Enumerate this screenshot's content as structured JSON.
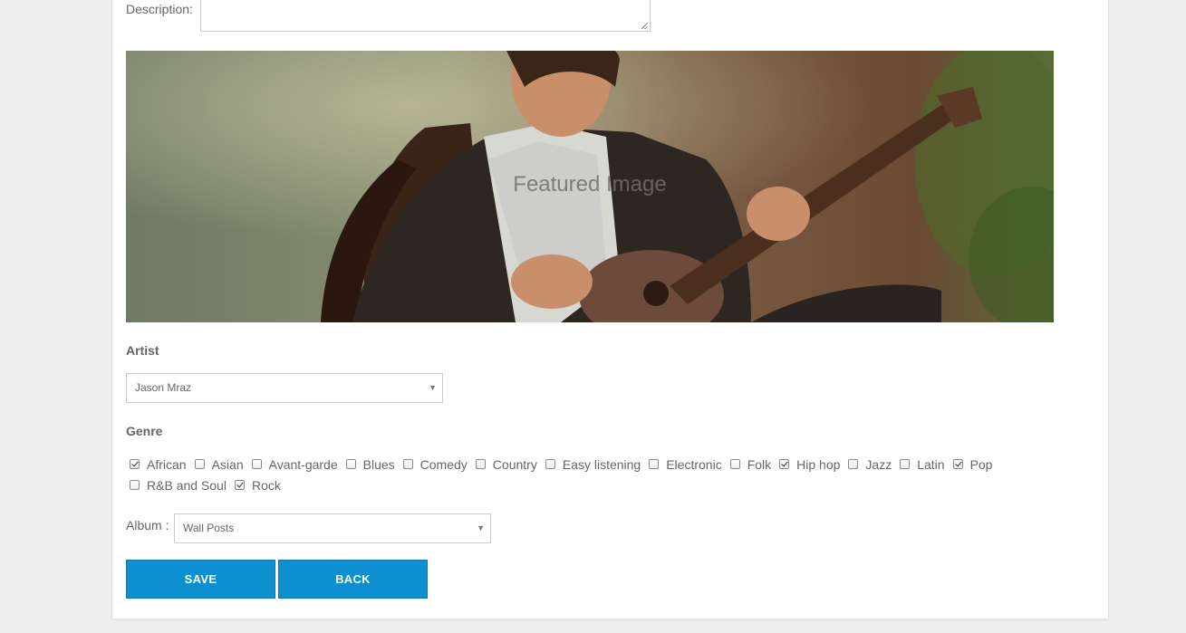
{
  "form": {
    "description_label": "Description:",
    "featured_image_caption": "Featured Image",
    "artist_label": "Artist",
    "artist_value": "Jason Mraz",
    "genre_label": "Genre",
    "genres_row1": [
      {
        "label": "African",
        "checked": true
      },
      {
        "label": "Asian",
        "checked": false
      },
      {
        "label": "Avant-garde",
        "checked": false
      },
      {
        "label": "Blues",
        "checked": false
      },
      {
        "label": "Comedy",
        "checked": false
      },
      {
        "label": "Country",
        "checked": false
      },
      {
        "label": "Easy listening",
        "checked": false
      },
      {
        "label": "Electronic",
        "checked": false
      },
      {
        "label": "Folk",
        "checked": false
      },
      {
        "label": "Hip hop",
        "checked": true
      },
      {
        "label": "Jazz",
        "checked": false
      },
      {
        "label": "Latin",
        "checked": false
      },
      {
        "label": "Pop",
        "checked": true
      }
    ],
    "genres_row2": [
      {
        "label": "R&B and Soul",
        "checked": false
      },
      {
        "label": "Rock",
        "checked": true
      }
    ],
    "album_label": "Album :",
    "album_value": "Wall Posts",
    "save_label": "SAVE",
    "back_label": "BACK"
  },
  "colors": {
    "button": "#0e8fd0",
    "background": "#eeeeee",
    "panel": "#ffffff"
  },
  "icons": {
    "select_arrow": "chevron-down-icon",
    "checkbox_check": "check-icon"
  }
}
